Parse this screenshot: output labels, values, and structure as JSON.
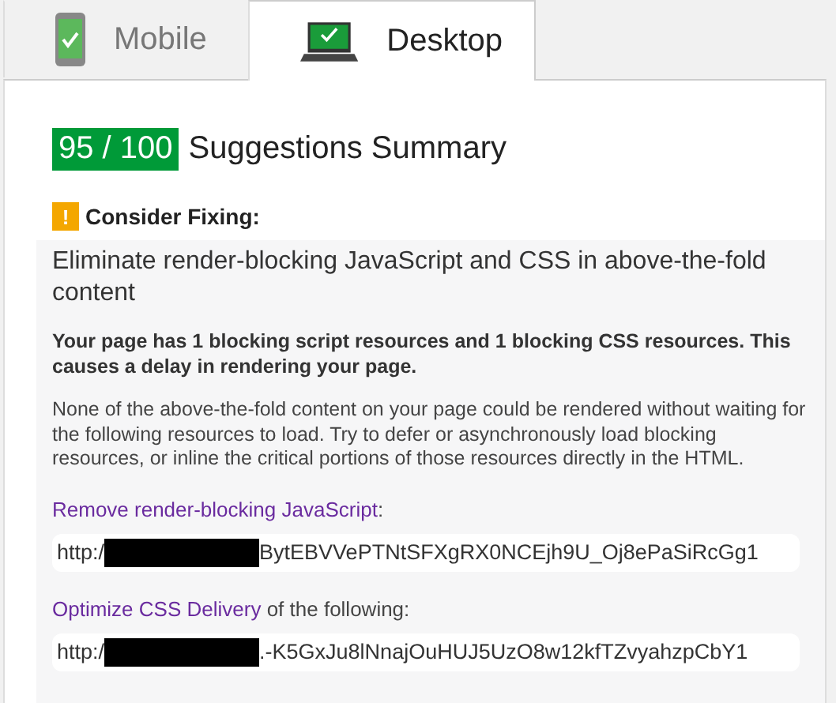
{
  "tabs": [
    {
      "label": "Mobile",
      "kind": "mobile",
      "selected": false
    },
    {
      "label": "Desktop",
      "kind": "desktop",
      "selected": true
    }
  ],
  "summary": {
    "score": "95 / 100",
    "title": "Suggestions Summary"
  },
  "section": {
    "badge": "!",
    "heading": "Consider Fixing:"
  },
  "rule": {
    "title": "Eliminate render-blocking JavaScript and CSS in above-the-fold content",
    "lead": "Your page has 1 blocking script resources and 1 blocking CSS resources. This causes a delay in rendering your page.",
    "body": "None of the above-the-fold content on your page could be rendered without waiting for the following resources to load. Try to defer or asynchronously load blocking resources, or inline the critical portions of those resources directly in the HTML.",
    "groups": [
      {
        "link": "Remove render-blocking JavaScript",
        "after": ":",
        "url_start": "http:/",
        "url_end": "BytEBVVePTNtSFXgRX0NCEjh9U_Oj8ePaSiRcGg1"
      },
      {
        "link": "Optimize CSS Delivery",
        "after": " of the following:",
        "url_start": "http:/",
        "url_end": ".-K5GxJu8lNnajOuHUJ5UzO8w12kfTZvyahzpCbY1"
      }
    ]
  }
}
